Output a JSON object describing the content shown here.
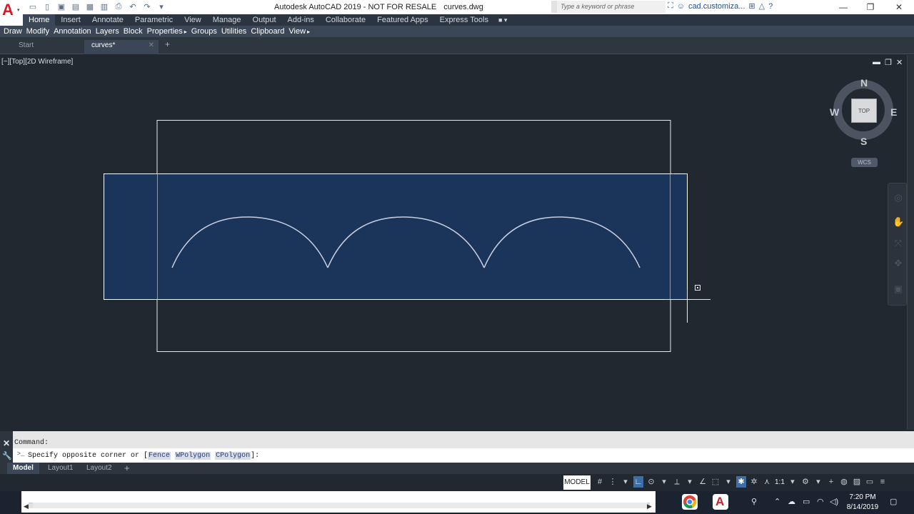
{
  "titlebar": {
    "app_title": "Autodesk AutoCAD 2019 - NOT FOR RESALE",
    "file_name": "curves.dwg",
    "search_placeholder": "Type a keyword or phrase",
    "user": "cad.customiza..."
  },
  "ribbon": {
    "tabs": [
      "Home",
      "Insert",
      "Annotate",
      "Parametric",
      "View",
      "Manage",
      "Output",
      "Add-ins",
      "Collaborate",
      "Featured Apps",
      "Express Tools"
    ],
    "active_tab": "Home",
    "panels": [
      "Draw",
      "Modify",
      "Annotation",
      "Layers",
      "Block",
      "Properties",
      "Groups",
      "Utilities",
      "Clipboard",
      "View"
    ]
  },
  "file_tabs": {
    "start": "Start",
    "active": "curves*"
  },
  "viewport": {
    "label": "[−][Top][2D Wireframe]",
    "viewcube": {
      "top": "TOP",
      "north": "N",
      "south": "S",
      "east": "E",
      "west": "W",
      "wcs": "WCS"
    }
  },
  "command": {
    "history": "Command:",
    "prompt_prefix": "Specify opposite corner or [",
    "options": [
      "Fence",
      "WPolygon",
      "CPolygon"
    ],
    "prompt_suffix": "]:"
  },
  "layout_tabs": [
    "Model",
    "Layout1",
    "Layout2"
  ],
  "statusbar": {
    "model": "MODEL",
    "scale": "1:1"
  },
  "taskbar": {
    "time": "7:20 PM",
    "date": "8/14/2019"
  },
  "colors": {
    "canvas": "#212830",
    "selection_fill": "#1a355e",
    "selection_border": "#ffffff",
    "arc": "#c9cfe0",
    "ribbon_active": "#3b4756",
    "autocad_red": "#d21e26"
  }
}
